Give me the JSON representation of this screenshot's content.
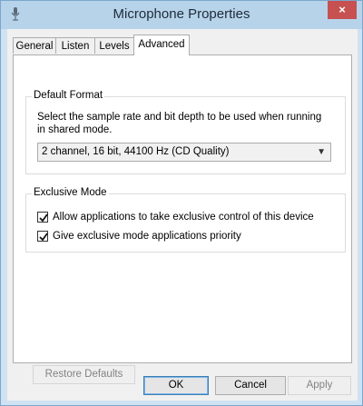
{
  "window": {
    "title": "Microphone Properties",
    "close_glyph": "×",
    "icon": "microphone-icon"
  },
  "tabs": [
    {
      "label": "General",
      "active": false
    },
    {
      "label": "Listen",
      "active": false
    },
    {
      "label": "Levels",
      "active": false
    },
    {
      "label": "Advanced",
      "active": true
    }
  ],
  "default_format": {
    "title": "Default Format",
    "description": "Select the sample rate and bit depth to be used when running in shared mode.",
    "selected": "2 channel, 16 bit, 44100 Hz (CD Quality)"
  },
  "exclusive_mode": {
    "title": "Exclusive Mode",
    "options": [
      {
        "label": "Allow applications to take exclusive control of this device",
        "checked": true
      },
      {
        "label": "Give exclusive mode applications priority",
        "checked": true
      }
    ]
  },
  "buttons": {
    "restore": "Restore Defaults",
    "ok": "OK",
    "cancel": "Cancel",
    "apply": "Apply"
  }
}
